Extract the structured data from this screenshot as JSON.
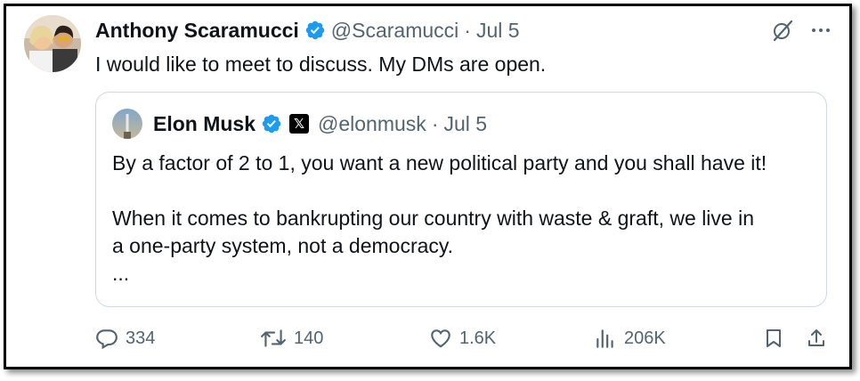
{
  "tweet": {
    "author_name": "Anthony Scaramucci",
    "handle": "@Scaramucci",
    "separator": "·",
    "date": "Jul 5",
    "text": "I would like to meet to discuss. My DMs are open."
  },
  "quote": {
    "author_name": "Elon Musk",
    "affiliate_badge": "𝕏",
    "handle": "@elonmusk",
    "separator": "·",
    "date": "Jul 5",
    "line1": "By a factor of 2 to 1, you want a new political party and you shall have it!",
    "line2": "When it comes to bankrupting our country with waste & graft, we live in",
    "line3": "a one-party system, not a democracy.",
    "line4": "..."
  },
  "actions": {
    "replies": "334",
    "reposts": "140",
    "likes": "1.6K",
    "views": "206K"
  },
  "icons": {
    "verified": "verified-badge-icon",
    "grok": "grok-icon",
    "more": "more-icon",
    "reply": "reply-icon",
    "repost": "repost-icon",
    "like": "heart-icon",
    "views": "views-icon",
    "bookmark": "bookmark-icon",
    "share": "share-icon"
  },
  "colors": {
    "verified_blue": "#1d9bf0",
    "secondary_text": "#536471",
    "border": "#cfd9de"
  }
}
